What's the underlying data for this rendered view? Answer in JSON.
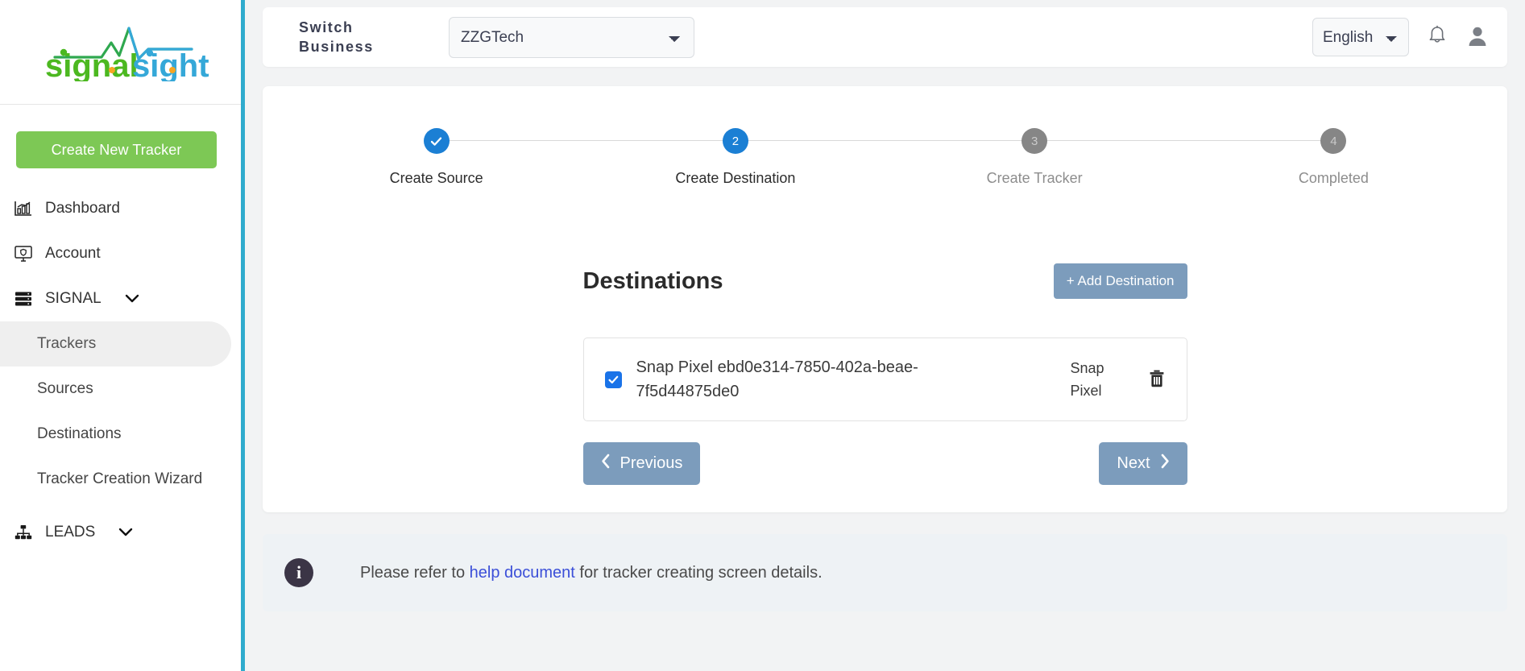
{
  "brand": {
    "name_part1": "signal",
    "name_part2": "sight",
    "color_green": "#4cb820",
    "color_blue": "#35a8d8",
    "color_orange": "#f5a623"
  },
  "sidebar": {
    "create_button": "Create New Tracker",
    "items": [
      {
        "label": "Dashboard",
        "icon": "chart-bar-icon"
      },
      {
        "label": "Account",
        "icon": "monitor-shield-icon"
      },
      {
        "label": "SIGNAL",
        "icon": "server-icon",
        "expandable": true
      }
    ],
    "signal_children": [
      {
        "label": "Trackers",
        "active": true
      },
      {
        "label": "Sources",
        "active": false
      },
      {
        "label": "Destinations",
        "active": false
      },
      {
        "label": "Tracker Creation Wizard",
        "active": false
      }
    ],
    "leads": {
      "label": "LEADS",
      "icon": "sitemap-icon",
      "expandable": true
    },
    "divider_color": "#2fabcd"
  },
  "topbar": {
    "switch_business_label": "Switch Business",
    "business_selected": "ZZGTech",
    "business_options": [
      "ZZGTech"
    ],
    "language_selected": "English",
    "language_options": [
      "English"
    ],
    "notification_icon": "bell-icon",
    "avatar_icon": "user-avatar-icon"
  },
  "wizard": {
    "steps": [
      {
        "number": "1",
        "label": "Create Source",
        "state": "done",
        "marker": "✓"
      },
      {
        "number": "2",
        "label": "Create Destination",
        "state": "active",
        "marker": "2"
      },
      {
        "number": "3",
        "label": "Create Tracker",
        "state": "idle",
        "marker": "3"
      },
      {
        "number": "4",
        "label": "Completed",
        "state": "idle",
        "marker": "4"
      }
    ],
    "active_color": "#1b7fd4",
    "idle_color": "#868686"
  },
  "destinations": {
    "title": "Destinations",
    "add_button": "+ Add Destination",
    "rows": [
      {
        "checked": true,
        "name": "Snap Pixel ebd0e314-7850-402a-beae-7f5d44875de0",
        "type": "Snap Pixel",
        "delete_icon": "trash-icon"
      }
    ]
  },
  "footer_nav": {
    "previous_label": "Previous",
    "previous_icon": "chevron-left-icon",
    "next_label": "Next",
    "next_icon": "chevron-right-icon",
    "button_color": "#7c9cbc"
  },
  "info_bar": {
    "icon": "info-icon",
    "text_before": "Please refer to ",
    "link_text": "help document",
    "text_after": " for tracker creating screen details.",
    "link_color": "#3b4fd8"
  }
}
